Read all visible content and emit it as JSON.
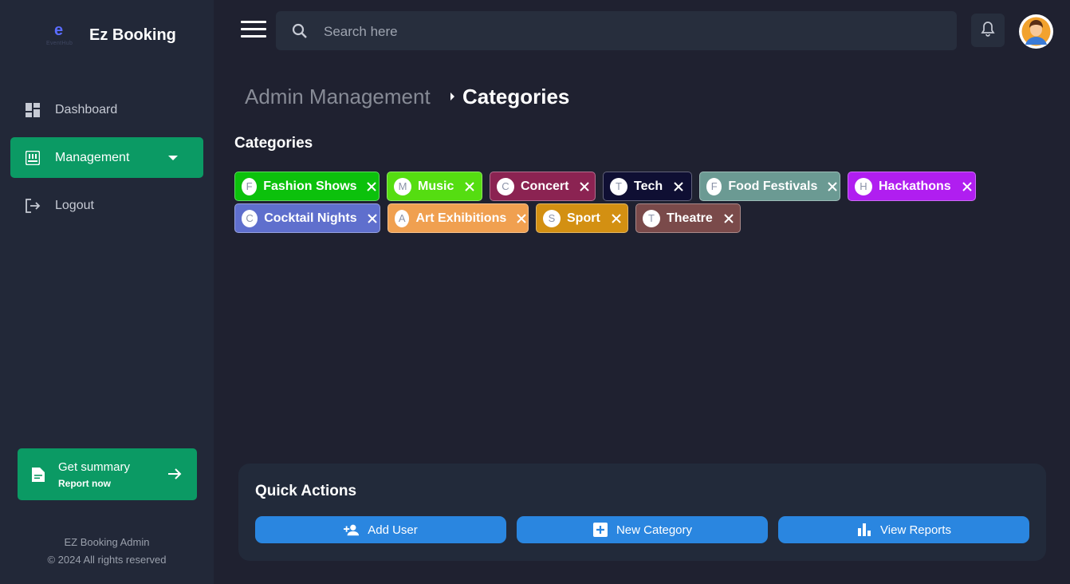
{
  "brand": {
    "name": "Ez Booking",
    "logo_letter": "e",
    "logo_caption": "EventHub"
  },
  "sidebar": {
    "items": [
      {
        "label": "Dashboard",
        "icon": "dashboard-icon"
      },
      {
        "label": "Management",
        "icon": "management-icon",
        "active": true
      },
      {
        "label": "Logout",
        "icon": "logout-icon"
      }
    ],
    "summary": {
      "title": "Get summary",
      "subtitle": "Report now"
    },
    "footer": {
      "line1": "EZ Booking Admin",
      "line2": "© 2024 All rights reserved"
    }
  },
  "topbar": {
    "search_placeholder": "Search here"
  },
  "breadcrumb": {
    "root": "Admin Management",
    "current": "Categories"
  },
  "categories": {
    "title": "Categories",
    "items": [
      {
        "letter": "F",
        "label": "Fashion Shows",
        "color": "#0cc10c"
      },
      {
        "letter": "M",
        "label": "Music",
        "color": "#55dd11"
      },
      {
        "letter": "C",
        "label": "Concert",
        "color": "#8b2352"
      },
      {
        "letter": "T",
        "label": "Tech",
        "color": "#0f0f33"
      },
      {
        "letter": "F",
        "label": "Food Festivals",
        "color": "#6b9a93"
      },
      {
        "letter": "H",
        "label": "Hackathons",
        "color": "#b01ef0"
      },
      {
        "letter": "C",
        "label": "Cocktail Nights",
        "color": "#5f6fcd"
      },
      {
        "letter": "A",
        "label": "Art Exhibitions",
        "color": "#f0a050"
      },
      {
        "letter": "S",
        "label": "Sport",
        "color": "#d39012"
      },
      {
        "letter": "T",
        "label": "Theatre",
        "color": "#7a4a4a"
      }
    ]
  },
  "quick_actions": {
    "title": "Quick Actions",
    "buttons": [
      {
        "label": "Add User",
        "icon": "add-user-icon"
      },
      {
        "label": "New Category",
        "icon": "add-box-icon"
      },
      {
        "label": "View Reports",
        "icon": "bar-chart-icon"
      }
    ]
  },
  "colors": {
    "accent": "#0b9a64",
    "primary_button": "#2a86e0",
    "background": "#1f2130",
    "sidebar": "#222838"
  }
}
